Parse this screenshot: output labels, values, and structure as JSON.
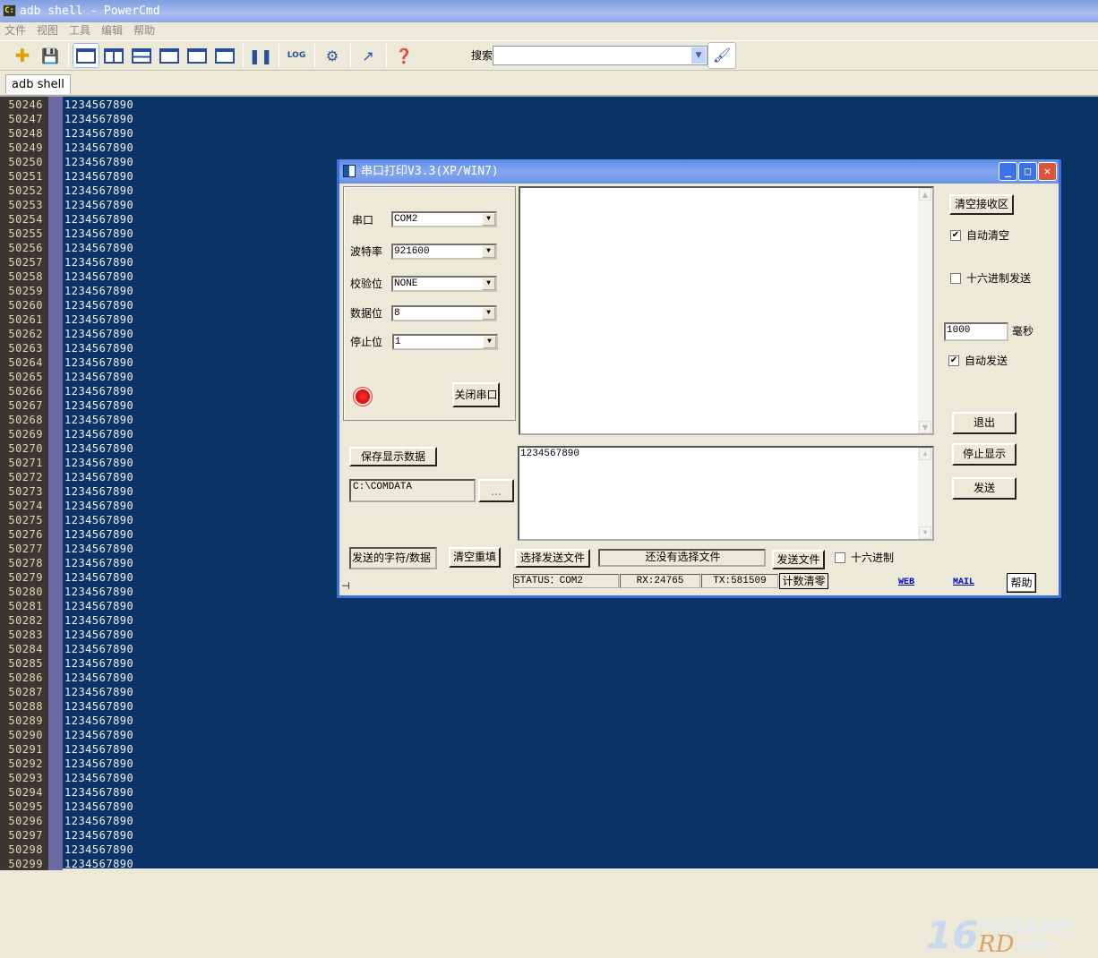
{
  "window": {
    "title": "adb shell - PowerCmd"
  },
  "menu": [
    "文件",
    "视图",
    "工具",
    "编辑",
    "帮助"
  ],
  "toolbar": {
    "search_label": "搜索",
    "search_value": ""
  },
  "tabs": [
    {
      "label": "adb shell"
    }
  ],
  "terminal": {
    "lines": [
      [
        "50246",
        "1234567890"
      ],
      [
        "50247",
        "1234567890"
      ],
      [
        "50248",
        "1234567890"
      ],
      [
        "50249",
        "1234567890"
      ],
      [
        "50250",
        "1234567890"
      ],
      [
        "50251",
        "1234567890"
      ],
      [
        "50252",
        "1234567890"
      ],
      [
        "50253",
        "1234567890"
      ],
      [
        "50254",
        "1234567890"
      ],
      [
        "50255",
        "1234567890"
      ],
      [
        "50256",
        "1234567890"
      ],
      [
        "50257",
        "1234567890"
      ],
      [
        "50258",
        "1234567890"
      ],
      [
        "50259",
        "1234567890"
      ],
      [
        "50260",
        "1234567890"
      ],
      [
        "50261",
        "1234567890"
      ],
      [
        "50262",
        "1234567890"
      ],
      [
        "50263",
        "1234567890"
      ],
      [
        "50264",
        "1234567890"
      ],
      [
        "50265",
        "1234567890"
      ],
      [
        "50266",
        "1234567890"
      ],
      [
        "50267",
        "1234567890"
      ],
      [
        "50268",
        "1234567890"
      ],
      [
        "50269",
        "1234567890"
      ],
      [
        "50270",
        "1234567890"
      ],
      [
        "50271",
        "1234567890"
      ],
      [
        "50272",
        "1234567890"
      ],
      [
        "50273",
        "1234567890"
      ],
      [
        "50274",
        "1234567890"
      ],
      [
        "50275",
        "1234567890"
      ],
      [
        "50276",
        "1234567890"
      ],
      [
        "50277",
        "1234567890"
      ],
      [
        "50278",
        "1234567890"
      ],
      [
        "50279",
        "1234567890"
      ],
      [
        "50280",
        "1234567890"
      ],
      [
        "50281",
        "1234567890"
      ],
      [
        "50282",
        "1234567890"
      ],
      [
        "50283",
        "1234567890"
      ],
      [
        "50284",
        "1234567890"
      ],
      [
        "50285",
        "1234567890"
      ],
      [
        "50286",
        "1234567890"
      ],
      [
        "50287",
        "1234567890"
      ],
      [
        "50288",
        "1234567890"
      ],
      [
        "50289",
        "1234567890"
      ],
      [
        "50290",
        "1234567890"
      ],
      [
        "50291",
        "1234567890"
      ],
      [
        "50292",
        "1234567890"
      ],
      [
        "50293",
        "1234567890"
      ],
      [
        "50294",
        "1234567890"
      ],
      [
        "50295",
        "1234567890"
      ],
      [
        "50296",
        "1234567890"
      ],
      [
        "50297",
        "1234567890"
      ],
      [
        "50298",
        "1234567890"
      ],
      [
        "50299",
        "1234567890"
      ]
    ]
  },
  "watermark": {
    "num": "16",
    "cn": "手机开发联盟",
    "rd": "RD",
    "com": ".COM"
  },
  "dialog": {
    "title": "串口打印V3.3(XP/WIN7)",
    "port_label": "串口",
    "port_value": "COM2",
    "baud_label": "波特率",
    "baud_value": "921600",
    "parity_label": "校验位",
    "parity_value": "NONE",
    "databits_label": "数据位",
    "databits_value": "8",
    "stopbits_label": "停止位",
    "stopbits_value": "1",
    "close_port": "关闭串口",
    "receive_text": "",
    "clear_receive": "清空接收区",
    "auto_clear": {
      "label": "自动清空",
      "checked": true
    },
    "hex_send": {
      "label": "十六进制发送",
      "checked": false
    },
    "interval_value": "1000",
    "interval_unit": "毫秒",
    "auto_send": {
      "label": "自动发送",
      "checked": true
    },
    "exit": "退出",
    "stop_display": "停止显示",
    "send": "发送",
    "save_data": "保存显示数据",
    "save_path": "C:\\COMDATA",
    "browse": "...",
    "send_text": "1234567890",
    "send_label": "发送的字符/数据",
    "clear_refill": "清空重填",
    "choose_file": "选择发送文件",
    "file_status": "还没有选择文件",
    "send_file": "发送文件",
    "hex": {
      "label": "十六进制",
      "checked": false
    },
    "status": "STATUS：COM2",
    "rx": "RX:24765",
    "tx": "TX:581509",
    "reset_count": "计数清零",
    "web": "WEB",
    "mail": "MAIL",
    "help": "帮助"
  }
}
